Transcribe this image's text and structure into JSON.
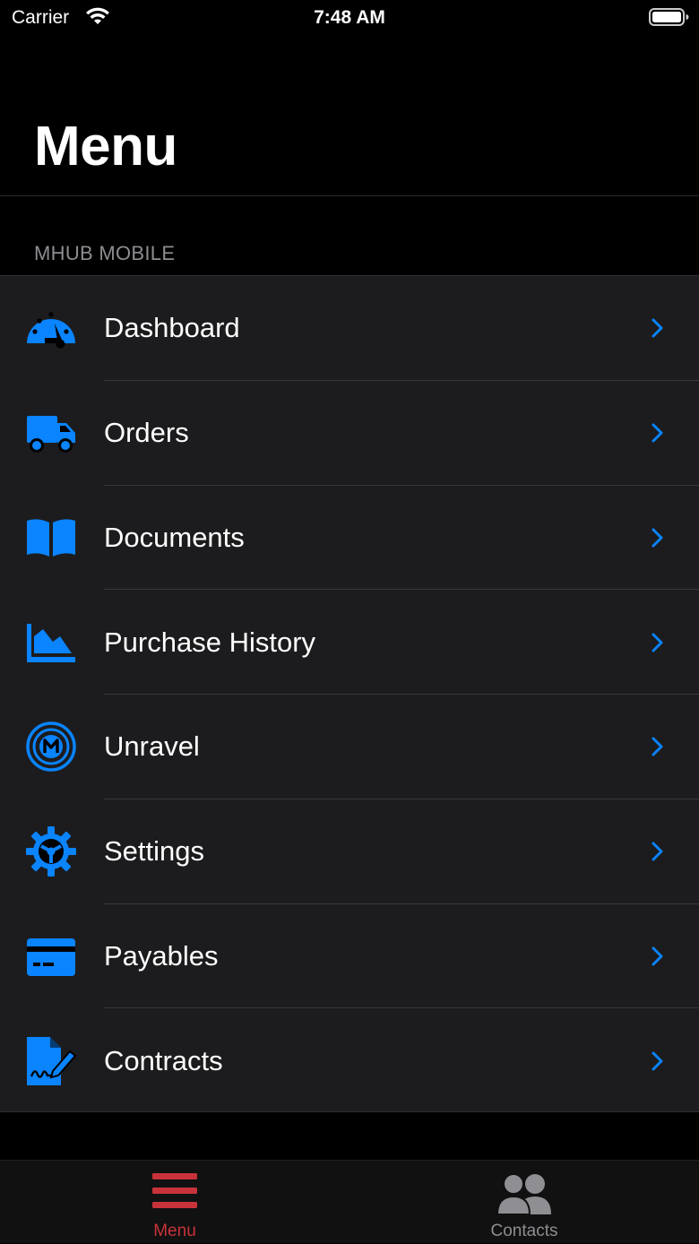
{
  "status_bar": {
    "carrier": "Carrier",
    "time": "7:48 AM"
  },
  "header": {
    "title": "Menu"
  },
  "section": {
    "label": "MHUB MOBILE"
  },
  "menu_items": [
    {
      "label": "Dashboard",
      "icon": "dashboard-gauge-icon"
    },
    {
      "label": "Orders",
      "icon": "truck-icon"
    },
    {
      "label": "Documents",
      "icon": "open-book-icon"
    },
    {
      "label": "Purchase History",
      "icon": "area-chart-icon"
    },
    {
      "label": "Unravel",
      "icon": "m-circle-icon"
    },
    {
      "label": "Settings",
      "icon": "gear-icon"
    },
    {
      "label": "Payables",
      "icon": "credit-card-icon"
    },
    {
      "label": "Contracts",
      "icon": "signature-document-icon"
    }
  ],
  "tab_bar": {
    "tabs": [
      {
        "label": "Menu",
        "icon": "hamburger-icon",
        "selected": true
      },
      {
        "label": "Contacts",
        "icon": "contacts-people-icon",
        "selected": false
      }
    ]
  },
  "colors": {
    "accent_blue": "#0a84ff",
    "tab_active_red": "#c8333b",
    "row_background": "#1c1c1e"
  }
}
